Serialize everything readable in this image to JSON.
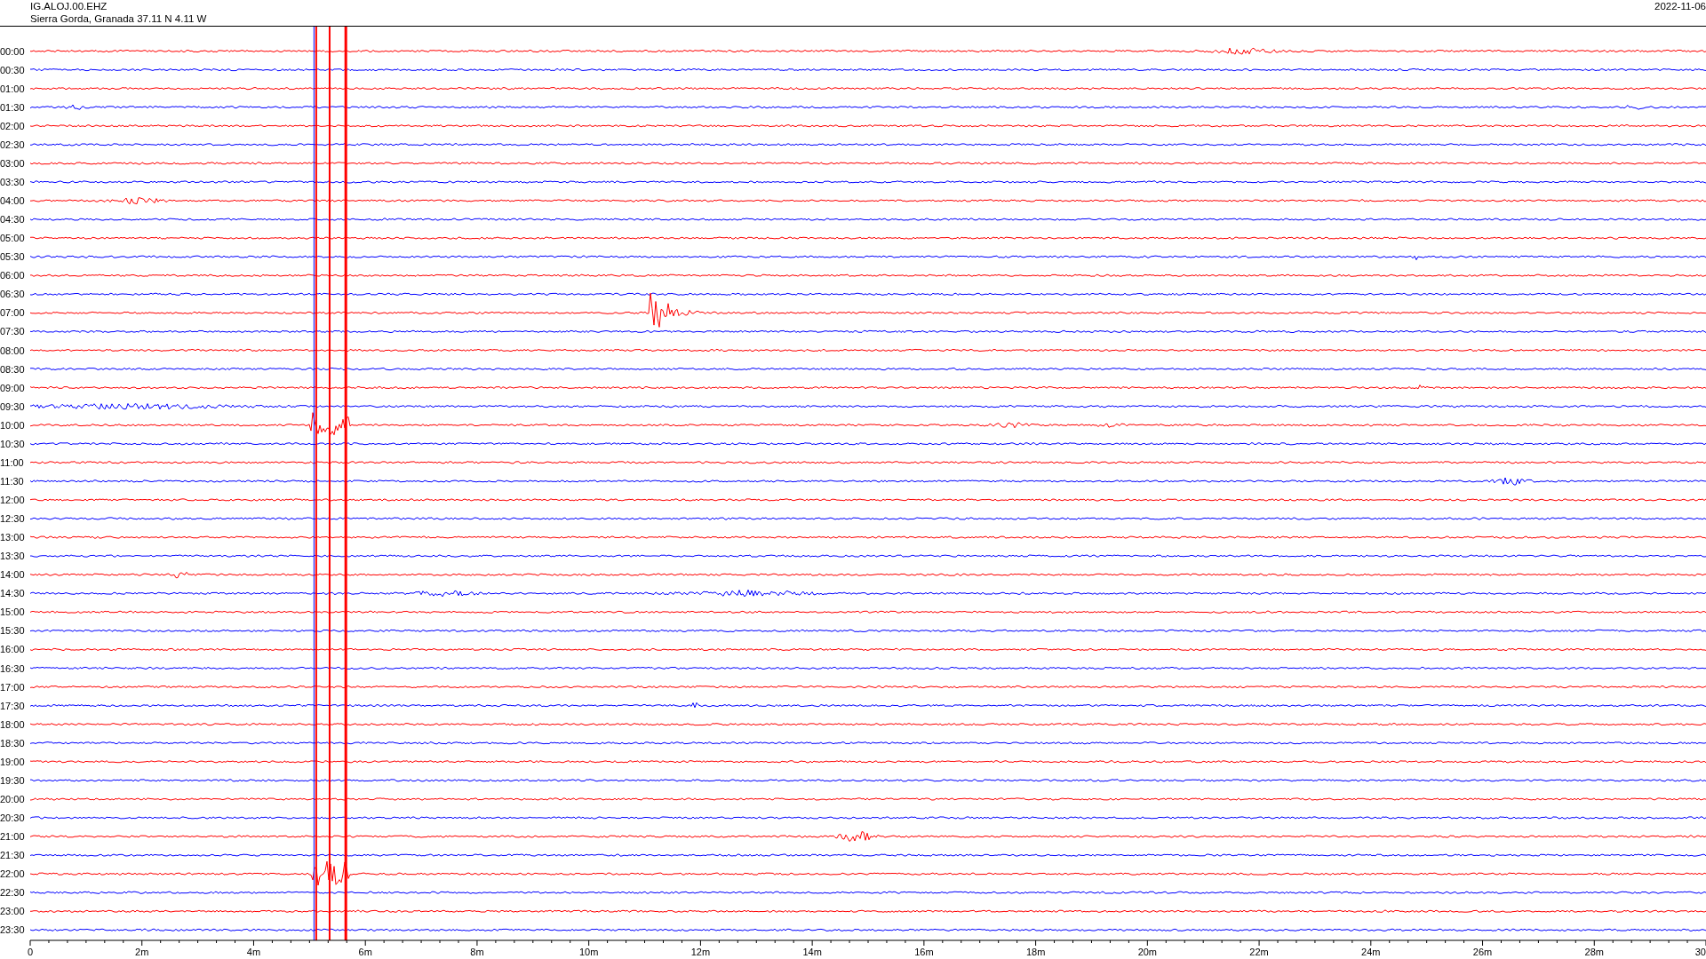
{
  "header": {
    "station": "IG.ALOJ.00.EHZ",
    "location": "Sierra Gorda, Granada  37.11 N 4.11 W",
    "date": "2022-11-06"
  },
  "rows": [
    {
      "label": "00:00",
      "color": "#ff0000"
    },
    {
      "label": "00:30",
      "color": "#0000ff"
    },
    {
      "label": "01:00",
      "color": "#ff0000"
    },
    {
      "label": "01:30",
      "color": "#0000ff"
    },
    {
      "label": "02:00",
      "color": "#ff0000"
    },
    {
      "label": "02:30",
      "color": "#0000ff"
    },
    {
      "label": "03:00",
      "color": "#ff0000"
    },
    {
      "label": "03:30",
      "color": "#0000ff"
    },
    {
      "label": "04:00",
      "color": "#ff0000"
    },
    {
      "label": "04:30",
      "color": "#0000ff"
    },
    {
      "label": "05:00",
      "color": "#ff0000"
    },
    {
      "label": "05:30",
      "color": "#0000ff"
    },
    {
      "label": "06:00",
      "color": "#ff0000"
    },
    {
      "label": "06:30",
      "color": "#0000ff"
    },
    {
      "label": "07:00",
      "color": "#ff0000"
    },
    {
      "label": "07:30",
      "color": "#0000ff"
    },
    {
      "label": "08:00",
      "color": "#ff0000"
    },
    {
      "label": "08:30",
      "color": "#0000ff"
    },
    {
      "label": "09:00",
      "color": "#ff0000"
    },
    {
      "label": "09:30",
      "color": "#0000ff"
    },
    {
      "label": "10:00",
      "color": "#ff0000"
    },
    {
      "label": "10:30",
      "color": "#0000ff"
    },
    {
      "label": "11:00",
      "color": "#ff0000"
    },
    {
      "label": "11:30",
      "color": "#0000ff"
    },
    {
      "label": "12:00",
      "color": "#ff0000"
    },
    {
      "label": "12:30",
      "color": "#0000ff"
    },
    {
      "label": "13:00",
      "color": "#ff0000"
    },
    {
      "label": "13:30",
      "color": "#0000ff"
    },
    {
      "label": "14:00",
      "color": "#ff0000"
    },
    {
      "label": "14:30",
      "color": "#0000ff"
    },
    {
      "label": "15:00",
      "color": "#ff0000"
    },
    {
      "label": "15:30",
      "color": "#0000ff"
    },
    {
      "label": "16:00",
      "color": "#ff0000"
    },
    {
      "label": "16:30",
      "color": "#0000ff"
    },
    {
      "label": "17:00",
      "color": "#ff0000"
    },
    {
      "label": "17:30",
      "color": "#0000ff"
    },
    {
      "label": "18:00",
      "color": "#ff0000"
    },
    {
      "label": "18:30",
      "color": "#0000ff"
    },
    {
      "label": "19:00",
      "color": "#ff0000"
    },
    {
      "label": "19:30",
      "color": "#0000ff"
    },
    {
      "label": "20:00",
      "color": "#ff0000"
    },
    {
      "label": "20:30",
      "color": "#0000ff"
    },
    {
      "label": "21:00",
      "color": "#ff0000"
    },
    {
      "label": "21:30",
      "color": "#0000ff"
    },
    {
      "label": "22:00",
      "color": "#ff0000"
    },
    {
      "label": "22:30",
      "color": "#0000ff"
    },
    {
      "label": "23:00",
      "color": "#ff0000"
    },
    {
      "label": "23:30",
      "color": "#0000ff"
    }
  ],
  "x_axis": {
    "ticks": [
      "0",
      "2m",
      "4m",
      "6m",
      "8m",
      "10m",
      "12m",
      "14m",
      "16m",
      "18m",
      "20m",
      "22m",
      "24m",
      "26m",
      "28m",
      "30"
    ]
  }
}
